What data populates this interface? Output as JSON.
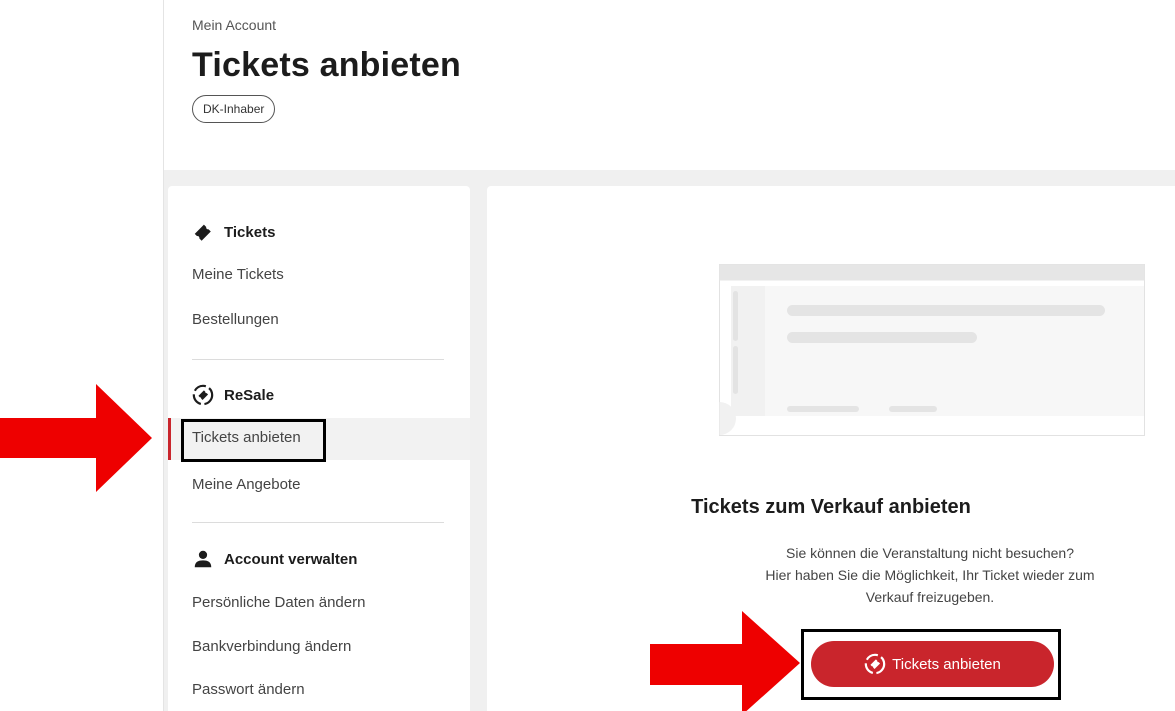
{
  "header": {
    "breadcrumb": "Mein Account",
    "title": "Tickets anbieten",
    "badge": "DK-Inhaber"
  },
  "sidebar": {
    "sections": [
      {
        "title": "Tickets",
        "icon": "ticket-icon",
        "items": [
          "Meine Tickets",
          "Bestellungen"
        ]
      },
      {
        "title": "ReSale",
        "icon": "resale-icon",
        "items": [
          "Tickets anbieten",
          "Meine Angebote"
        ]
      },
      {
        "title": "Account verwalten",
        "icon": "person-icon",
        "items": [
          "Persönliche Daten ändern",
          "Bankverbindung ändern",
          "Passwort ändern"
        ]
      }
    ],
    "active_item": "Tickets anbieten"
  },
  "main": {
    "heading": "Tickets zum Verkauf anbieten",
    "description_lines": [
      "Sie können die Veranstaltung nicht besuchen?",
      "Hier haben Sie die Möglichkeit, Ihr Ticket wieder zum",
      "Verkauf freizugeben."
    ],
    "button_label": "Tickets anbieten",
    "button_icon": "resale-icon"
  },
  "colors": {
    "accent": "#c9252c",
    "annotation_arrow": "#ee0000",
    "annotation_box": "#000000",
    "background_band": "#f0f0f0"
  }
}
